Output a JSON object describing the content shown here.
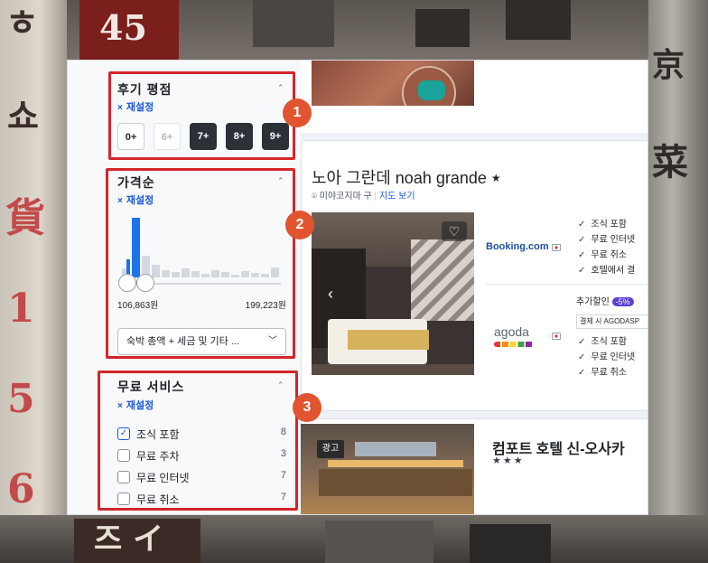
{
  "review_filter": {
    "badge": "1",
    "title": "후기 평점",
    "reset_label": "재설정",
    "scores": [
      {
        "label": "0+",
        "state": "light"
      },
      {
        "label": "6+",
        "state": "disabled"
      },
      {
        "label": "7+",
        "state": "dark"
      },
      {
        "label": "8+",
        "state": "dark"
      },
      {
        "label": "9+",
        "state": "dark"
      }
    ]
  },
  "price_filter": {
    "badge": "2",
    "title": "가격순",
    "reset_label": "재설정",
    "histogram_levels": [
      0.15,
      0.95,
      0.35,
      0.2,
      0.12,
      0.08,
      0.14,
      0.1,
      0.06,
      0.12,
      0.08,
      0.05,
      0.1,
      0.07,
      0.06,
      0.16
    ],
    "min_label": "106,863원",
    "max_label": "199,223원",
    "dropdown_value": "숙박 총액 + 세금 및 기타 ..."
  },
  "free_services": {
    "badge": "3",
    "title": "무료 서비스",
    "reset_label": "재설정",
    "items": [
      {
        "label": "조식 포함",
        "count": "8",
        "checked": true
      },
      {
        "label": "무료 주차",
        "count": "3",
        "checked": false
      },
      {
        "label": "무료 인터넷",
        "count": "7",
        "checked": false
      },
      {
        "label": "무료 취소",
        "count": "7",
        "checked": false
      }
    ]
  },
  "listing1": {
    "name": "노아 그란데 noah grande",
    "star": "★",
    "location": "미야코지마 구",
    "map_link": "지도 보기",
    "booking": {
      "provider": "Booking.com",
      "features": [
        "조식 포함",
        "무료 인터넷",
        "무료 취소",
        "호텔에서 결"
      ]
    },
    "agoda": {
      "provider": "agoda",
      "discount_label": "추가할인",
      "discount_badge": "-5%",
      "payment_note": "결제 시 AGODASP",
      "features": [
        "조식 포함",
        "무료 인터넷",
        "무료 취소"
      ]
    }
  },
  "listing2": {
    "ad_label": "광고",
    "name": "컴포트 호텔 신-오사카",
    "stars": "★★★"
  },
  "colors": {
    "highlight_red": "#d3262b",
    "badge_orange": "#e0552f",
    "link_blue": "#1a56db",
    "slider_blue": "#1a73e8",
    "chip_dark": "#2c3138"
  },
  "icons": [
    "heart-icon",
    "chevron-left-icon",
    "map-pin-icon",
    "chevron-down-icon",
    "check-icon"
  ]
}
